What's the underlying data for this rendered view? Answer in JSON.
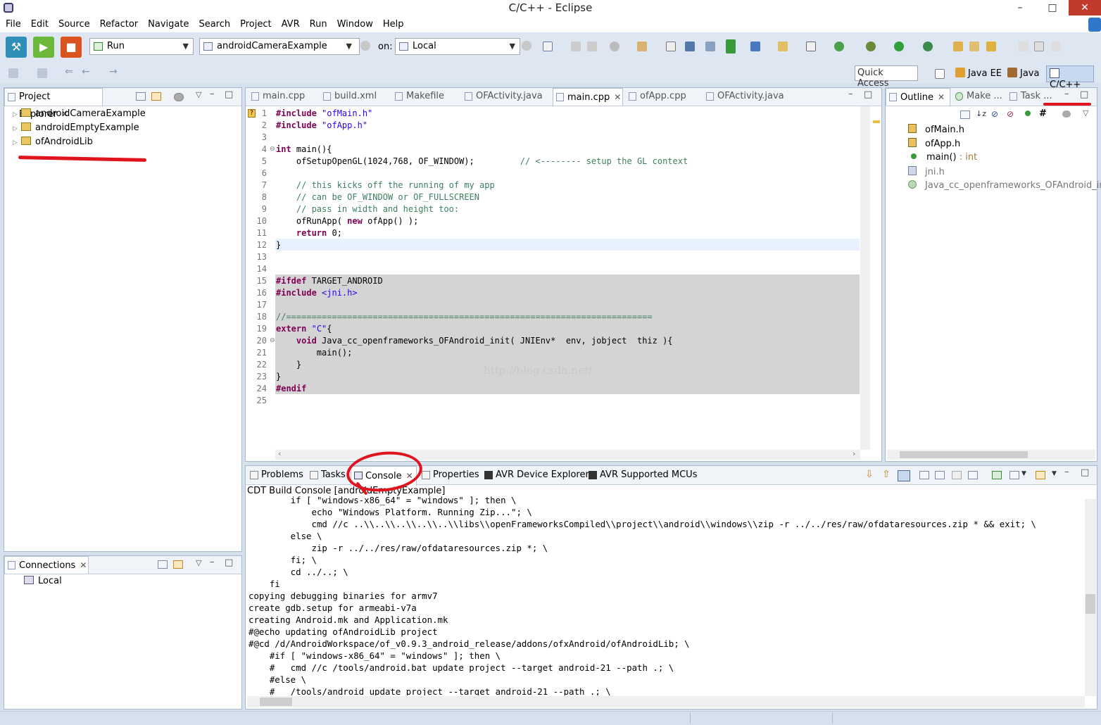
{
  "window": {
    "title": "C/C++ - Eclipse"
  },
  "menu": [
    "File",
    "Edit",
    "Source",
    "Refactor",
    "Navigate",
    "Search",
    "Project",
    "AVR",
    "Run",
    "Window",
    "Help"
  ],
  "toolbar": {
    "launch_mode": "Run",
    "launch_config": "androidCameraExample",
    "on_label": "on:",
    "target": "Local",
    "quick_access": "Quick Access",
    "perspectives": [
      "Java EE",
      "Java",
      "C/C++"
    ]
  },
  "project_explorer": {
    "title": "Project Explorer",
    "items": [
      "androidCameraExample",
      "androidEmptyExample",
      "ofAndroidLib"
    ]
  },
  "connections": {
    "title": "Connections",
    "items": [
      "Local"
    ]
  },
  "editor": {
    "tabs": [
      "main.cpp",
      "build.xml",
      "Makefile",
      "OFActivity.java",
      "main.cpp",
      "ofApp.cpp",
      "OFActivity.java"
    ],
    "active_tab": 4,
    "watermark": "http://blog.csdn.net/",
    "line_numbers": [
      "1",
      "2",
      "3",
      "4",
      "5",
      "6",
      "7",
      "8",
      "9",
      "10",
      "11",
      "12",
      "13",
      "14",
      "15",
      "16",
      "17",
      "18",
      "19",
      "20",
      "21",
      "22",
      "23",
      "24",
      "25"
    ]
  },
  "outline": {
    "tabs": [
      "Outline",
      "Make ...",
      "Task ..."
    ],
    "items": [
      "ofMain.h",
      "ofApp.h",
      "main()",
      "jni.h",
      "Java_cc_openframeworks_OFAndroid_init("
    ],
    "main_type": " : int"
  },
  "bottom": {
    "tabs": [
      "Problems",
      "Tasks",
      "Console",
      "Properties",
      "AVR Device Explorer",
      "AVR Supported MCUs"
    ],
    "console_title": "CDT Build Console [androidEmptyExample]",
    "console_lines": [
      "        if [ \"windows-x86_64\" = \"windows\" ]; then \\",
      "            echo \"Windows Platform. Running Zip...\"; \\",
      "            cmd //c ..\\\\..\\\\..\\\\..\\\\..\\\\libs\\\\openFrameworksCompiled\\\\project\\\\android\\\\windows\\\\zip -r ../../res/raw/ofdataresources.zip * && exit; \\",
      "        else \\",
      "            zip -r ../../res/raw/ofdataresources.zip *; \\",
      "        fi; \\",
      "        cd ../..; \\",
      "    fi",
      "copying debugging binaries for armv7",
      "create gdb.setup for armeabi-v7a",
      "creating Android.mk and Application.mk",
      "#@echo updating ofAndroidLib project",
      "#@cd /d/AndroidWorkspace/of_v0.9.3_android_release/addons/ofxAndroid/ofAndroidLib; \\",
      "    #if [ \"windows-x86_64\" = \"windows\" ]; then \\",
      "    #   cmd //c /tools/android.bat update project --target android-21 --path .; \\",
      "    #else \\",
      "    #   /tools/android update project --target android-21 --path .; \\"
    ]
  },
  "colors": {
    "accent": "#d6e1ee",
    "highlight": "#e8f2fe",
    "shade": "#d4d4d4",
    "annotation": "#e0141e"
  }
}
